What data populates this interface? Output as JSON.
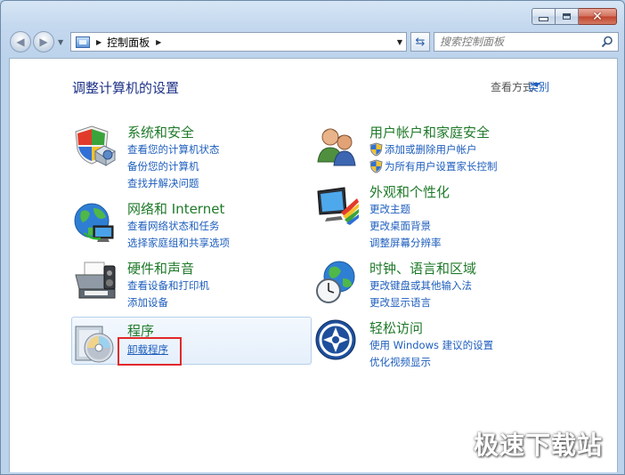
{
  "address": {
    "breadcrumb": "控制面板"
  },
  "search": {
    "placeholder": "搜索控制面板"
  },
  "header": {
    "title": "调整计算机的设置",
    "view_by_label": "查看方式:",
    "view_by_value": "类别"
  },
  "categories": [
    {
      "title": "系统和安全",
      "links": [
        "查看您的计算机状态",
        "备份您的计算机",
        "查找并解决问题"
      ]
    },
    {
      "title": "网络和 Internet",
      "links": [
        "查看网络状态和任务",
        "选择家庭组和共享选项"
      ]
    },
    {
      "title": "硬件和声音",
      "links": [
        "查看设备和打印机",
        "添加设备"
      ]
    },
    {
      "title": "程序",
      "links": [
        "卸载程序"
      ]
    },
    {
      "title": "用户帐户和家庭安全",
      "links": [
        "添加或删除用户帐户",
        "为所有用户设置家长控制"
      ]
    },
    {
      "title": "外观和个性化",
      "links": [
        "更改主题",
        "更改桌面背景",
        "调整屏幕分辨率"
      ]
    },
    {
      "title": "时钟、语言和区域",
      "links": [
        "更改键盘或其他输入法",
        "更改显示语言"
      ]
    },
    {
      "title": "轻松访问",
      "links": [
        "使用 Windows 建议的设置",
        "优化视频显示"
      ]
    }
  ],
  "watermark": "极速下载站",
  "colors": {
    "category_title": "#1f7a2a",
    "link": "#1e5ebd",
    "heading": "#1e3287",
    "highlight_border": "#e2282b"
  }
}
